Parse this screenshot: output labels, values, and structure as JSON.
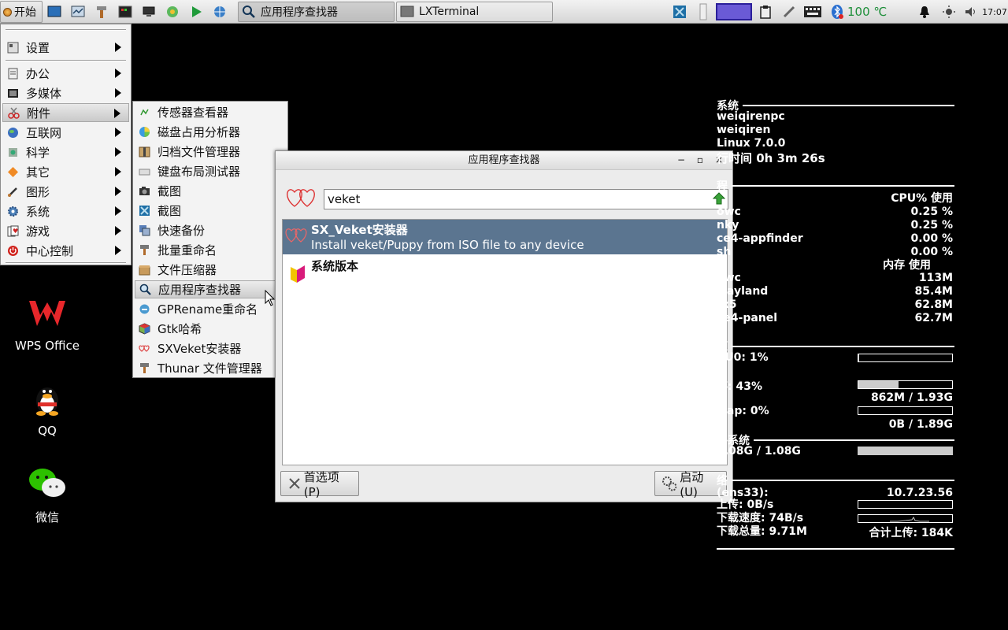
{
  "taskbar": {
    "start_label": "开始",
    "tasks": [
      "应用程序查找器",
      "LXTerminal"
    ],
    "temperature": "100 ℃",
    "clock": "17:07"
  },
  "start_menu": {
    "items": [
      "设置",
      "办公",
      "多媒体",
      "附件",
      "互联网",
      "科学",
      "其它",
      "图形",
      "系统",
      "游戏",
      "中心控制"
    ]
  },
  "submenu": {
    "items": [
      "传感器查看器",
      "磁盘占用分析器",
      "归档文件管理器",
      "键盘布局测试器",
      "截图",
      "截图",
      "快速备份",
      "批量重命名",
      "文件压缩器",
      "应用程序查找器",
      "GPRename重命名",
      "Gtk哈希",
      "SXVeket安装器",
      "Thunar 文件管理器"
    ]
  },
  "desktop": {
    "icons": [
      "WPS Office",
      "QQ",
      "微信"
    ]
  },
  "finder": {
    "title": "应用程序查找器",
    "search_value": "veket",
    "results": [
      {
        "name": "SX_Veket安装器",
        "desc": "Install veket/Puppy from ISO file to any device"
      },
      {
        "name": "系统版本",
        "desc": ""
      }
    ],
    "prefs_label": "首选项(P)",
    "launch_label": "启动(U)"
  },
  "conky": {
    "system_header": "系统",
    "hostname": "weiqirenpc",
    "user": "weiqiren",
    "kernel": "Linux 7.0.0",
    "uptime": "行时间 0h 3m 26s",
    "process_header": "程",
    "cpu_col": "CPU% 使用",
    "cpu_procs": [
      {
        "name": "owc",
        "val": "0.25 %"
      },
      {
        "name": "nky",
        "val": "0.25 %"
      },
      {
        "name": "ce4-appfinder",
        "val": "0.00 %"
      },
      {
        "name": "sh",
        "val": "0.00 %"
      }
    ],
    "mem_col": "内存 使用",
    "mem_procs": [
      {
        "name": "owc",
        "val": "113M"
      },
      {
        "name": "wayland",
        "val": "85.4M"
      },
      {
        "name": "tx5",
        "val": "62.8M"
      },
      {
        "name": "ce4-panel",
        "val": "62.7M"
      }
    ],
    "resource_header": "源",
    "cpu0": "PU0: 1%",
    "cpu0_level": 0.01,
    "mem": "存: 43%",
    "mem_level": 0.43,
    "mem_used": "862M / 1.93G",
    "swap": "wap: 0%",
    "swap_level": 0.0,
    "swap_used": "0B / 1.89G",
    "fs_header": "件系统",
    "fs": "1.08G / 1.08G",
    "fs_level": 1.0,
    "net_header": "络",
    "iface": "(ens33):",
    "ip": "10.7.23.56",
    "upload": "上传: 0B/s",
    "download": "下载速度: 74B/s",
    "download_total": "下载总量: 9.71M",
    "upload_total": "合计上传: 184K"
  }
}
